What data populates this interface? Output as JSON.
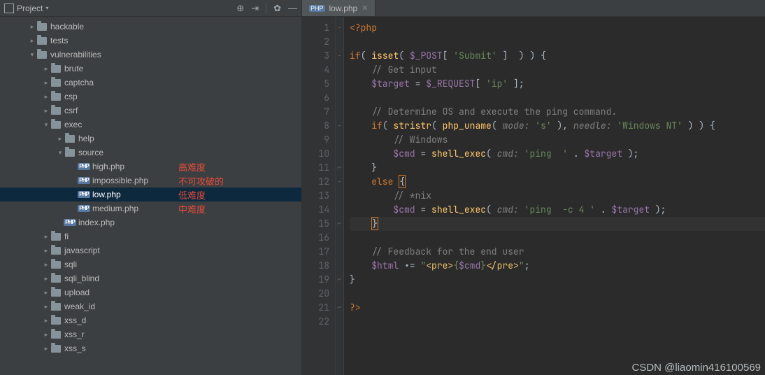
{
  "sidebar": {
    "title": "Project",
    "tree": [
      {
        "depth": 1,
        "arrow": "right",
        "type": "folder",
        "label": "hackable"
      },
      {
        "depth": 1,
        "arrow": "right",
        "type": "folder",
        "label": "tests"
      },
      {
        "depth": 1,
        "arrow": "down",
        "type": "folder",
        "label": "vulnerabilities"
      },
      {
        "depth": 2,
        "arrow": "right",
        "type": "folder",
        "label": "brute"
      },
      {
        "depth": 2,
        "arrow": "right",
        "type": "folder",
        "label": "captcha"
      },
      {
        "depth": 2,
        "arrow": "right",
        "type": "folder",
        "label": "csp"
      },
      {
        "depth": 2,
        "arrow": "right",
        "type": "folder",
        "label": "csrf"
      },
      {
        "depth": 2,
        "arrow": "down",
        "type": "folder",
        "label": "exec"
      },
      {
        "depth": 3,
        "arrow": "right",
        "type": "folder",
        "label": "help"
      },
      {
        "depth": 3,
        "arrow": "down",
        "type": "folder",
        "label": "source"
      },
      {
        "depth": 4,
        "arrow": "none",
        "type": "php",
        "label": "high.php",
        "annotation": "高难度"
      },
      {
        "depth": 4,
        "arrow": "none",
        "type": "php",
        "label": "impossible.php",
        "annotation": "不可攻破的"
      },
      {
        "depth": 4,
        "arrow": "none",
        "type": "php",
        "label": "low.php",
        "annotation": "低难度",
        "selected": true
      },
      {
        "depth": 4,
        "arrow": "none",
        "type": "php",
        "label": "medium.php",
        "annotation": "中难度"
      },
      {
        "depth": 3,
        "arrow": "none",
        "type": "php",
        "label": "index.php"
      },
      {
        "depth": 2,
        "arrow": "right",
        "type": "folder",
        "label": "fi"
      },
      {
        "depth": 2,
        "arrow": "right",
        "type": "folder",
        "label": "javascript"
      },
      {
        "depth": 2,
        "arrow": "right",
        "type": "folder",
        "label": "sqli"
      },
      {
        "depth": 2,
        "arrow": "right",
        "type": "folder",
        "label": "sqli_blind"
      },
      {
        "depth": 2,
        "arrow": "right",
        "type": "folder",
        "label": "upload"
      },
      {
        "depth": 2,
        "arrow": "right",
        "type": "folder",
        "label": "weak_id"
      },
      {
        "depth": 2,
        "arrow": "right",
        "type": "folder",
        "label": "xss_d"
      },
      {
        "depth": 2,
        "arrow": "right",
        "type": "folder",
        "label": "xss_r"
      },
      {
        "depth": 2,
        "arrow": "right",
        "type": "folder",
        "label": "xss_s"
      }
    ]
  },
  "tabs": [
    {
      "label": "low.php",
      "type": "php",
      "active": true
    }
  ],
  "editor": {
    "current_line": 15,
    "lines": [
      {
        "n": 1,
        "fold": "−",
        "html": "<span class='c-php'>&lt;?php</span>"
      },
      {
        "n": 2,
        "fold": "",
        "html": ""
      },
      {
        "n": 3,
        "fold": "−",
        "html": "<span class='c-kw'>if</span><span class='c-br'>( </span><span class='c-fn'>isset</span><span class='c-br'>( </span><span class='c-var'>$_POST</span><span class='c-br'>[ </span><span class='c-str'>'Submit'</span><span class='c-br'> ]  ) ) {</span>"
      },
      {
        "n": 4,
        "fold": "",
        "html": "    <span class='c-cmt'>// Get input</span>"
      },
      {
        "n": 5,
        "fold": "",
        "html": "    <span class='c-var'>$target</span><span class='c-br'> = </span><span class='c-var'>$_REQUEST</span><span class='c-br'>[ </span><span class='c-str'>'ip'</span><span class='c-br'> ];</span>"
      },
      {
        "n": 6,
        "fold": "",
        "html": ""
      },
      {
        "n": 7,
        "fold": "",
        "html": "    <span class='c-cmt'>// Determine OS and execute the ping command.</span>"
      },
      {
        "n": 8,
        "fold": "−",
        "html": "    <span class='c-kw'>if</span><span class='c-br'>( </span><span class='c-fn'>stristr</span><span class='c-br'>( </span><span class='c-fn'>php_uname</span><span class='c-br'>( </span><span class='c-param'>mode:</span><span class='c-br'> </span><span class='c-str'>'s'</span><span class='c-br'> ), </span><span class='c-param'>needle:</span><span class='c-br'> </span><span class='c-str'>'Windows NT'</span><span class='c-br'> ) ) {</span>"
      },
      {
        "n": 9,
        "fold": "",
        "html": "        <span class='c-cmt'>// Windows</span>"
      },
      {
        "n": 10,
        "fold": "",
        "html": "        <span class='c-var'>$cmd</span><span class='c-br'> = </span><span class='c-fn'>shell_exec</span><span class='c-br'>( </span><span class='c-param'>cmd:</span><span class='c-br'> </span><span class='c-str'>'ping  '</span><span class='c-br'> . </span><span class='c-var'>$target</span><span class='c-br'> );</span>"
      },
      {
        "n": 11,
        "fold": "⌐",
        "html": "    <span class='c-br'>}</span>"
      },
      {
        "n": 12,
        "fold": "−",
        "html": "    <span class='c-kw'>else</span><span class='c-br'> </span><span class='curly1'>{</span>"
      },
      {
        "n": 13,
        "fold": "",
        "html": "        <span class='c-cmt'>// *nix</span>"
      },
      {
        "n": 14,
        "fold": "",
        "html": "        <span class='c-var'>$cmd</span><span class='c-br'> = </span><span class='c-fn'>shell_exec</span><span class='c-br'>( </span><span class='c-param'>cmd:</span><span class='c-br'> </span><span class='c-str'>'ping  -c 4 '</span><span class='c-br'> . </span><span class='c-var'>$target</span><span class='c-br'> );</span>"
      },
      {
        "n": 15,
        "fold": "⌐",
        "html": "    <span class='curly1'>}</span>"
      },
      {
        "n": 16,
        "fold": "",
        "html": ""
      },
      {
        "n": 17,
        "fold": "",
        "html": "    <span class='c-cmt'>// Feedback for the end user</span>"
      },
      {
        "n": 18,
        "fold": "",
        "html": "    <span class='c-var'>$html</span><span class='c-br'> .= </span><span class='c-str'>\"</span><span class='c-tag'>&lt;pre&gt;</span><span class='c-str'>{</span><span class='c-var'>$cmd</span><span class='c-str'>}</span><span class='c-tag'>&lt;/pre&gt;</span><span class='c-str'>\"</span><span class='c-br'>;</span>"
      },
      {
        "n": 19,
        "fold": "⌐",
        "html": "<span class='c-br'>}</span>"
      },
      {
        "n": 20,
        "fold": "",
        "html": ""
      },
      {
        "n": 21,
        "fold": "⌐",
        "html": "<span class='c-php'>?&gt;</span>"
      },
      {
        "n": 22,
        "fold": "",
        "html": ""
      }
    ]
  },
  "watermark": "CSDN @liaomin416100569"
}
